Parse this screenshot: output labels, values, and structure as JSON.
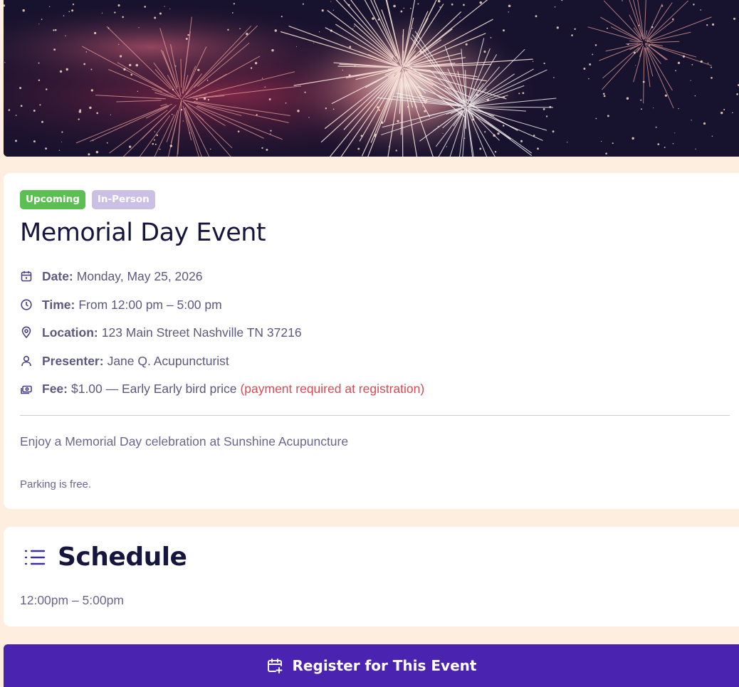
{
  "hero": {
    "image": "fireworks-banner"
  },
  "badges": {
    "upcoming": "Upcoming",
    "in_person": "In-Person"
  },
  "event": {
    "title": "Memorial Day Event",
    "date_label": "Date:",
    "date_value": "Monday, May 25, 2026",
    "time_label": "Time:",
    "time_value": "From 12:00 pm – 5:00 pm",
    "location_label": "Location:",
    "location_value": "123 Main Street Nashville TN 37216",
    "presenter_label": "Presenter:",
    "presenter_value": "Jane Q. Acupuncturist",
    "fee_label": "Fee:",
    "fee_value": "$1.00 — Early Early bird price",
    "fee_note": "(payment required at registration)",
    "description": "Enjoy a Memorial Day celebration at Sunshine Acupuncture",
    "parking": "Parking is free."
  },
  "schedule": {
    "title": "Schedule",
    "time": "12:00pm – 5:00pm"
  },
  "register": {
    "label": "Register for This Event"
  },
  "icons": {
    "date": "calendar-icon",
    "time": "clock-icon",
    "location": "map-pin-icon",
    "presenter": "user-icon",
    "fee": "money-icon",
    "schedule": "list-icon",
    "register": "calendar-plus-icon"
  },
  "colors": {
    "page_bg": "#fdeee0",
    "title": "#16153d",
    "upcoming": "#5cbf53",
    "in_person": "#cbbfe6",
    "warning": "#d94a53",
    "register_bg": "#4a23b1"
  }
}
